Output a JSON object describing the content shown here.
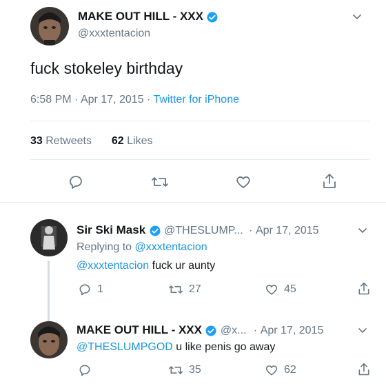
{
  "main_tweet": {
    "display_name": "MAKE OUT HILL - XXX",
    "handle": "@xxxtentacion",
    "text": "fuck stokeley birthday",
    "time": "6:58 PM",
    "date": "Apr 17, 2015",
    "source": "Twitter for iPhone",
    "retweets_count": "33",
    "retweets_label": "Retweets",
    "likes_count": "62",
    "likes_label": "Likes"
  },
  "reply1": {
    "display_name": "Sir Ski Mask",
    "handle": "@THESLUMP...",
    "date": "Apr 17, 2015",
    "replying_prefix": "Replying to",
    "replying_to": "@xxxtentacion",
    "mention": "@xxxtentacion",
    "text": "fuck ur aunty",
    "reply_count": "1",
    "retweet_count": "27",
    "like_count": "45"
  },
  "reply2": {
    "display_name": "MAKE OUT HILL - XXX",
    "handle": "@x...",
    "date": "Apr 17, 2015",
    "mention": "@THESLUMPGOD",
    "text": "u like penis go away",
    "retweet_count": "35",
    "like_count": "62"
  },
  "separator": "·",
  "colors": {
    "link": "#1b95e0",
    "muted": "#657786",
    "verified": "#1da1f2",
    "text": "#14171a"
  },
  "icons": [
    "chevron-down-icon",
    "verified-icon",
    "reply-icon",
    "retweet-icon",
    "like-icon",
    "share-icon"
  ]
}
